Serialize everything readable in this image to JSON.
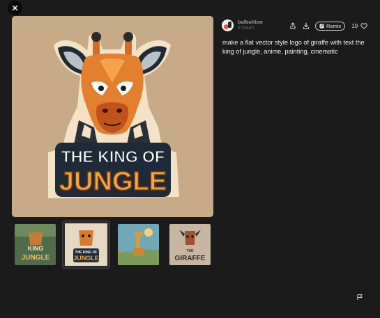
{
  "user": {
    "username": "balbolitoo",
    "time": "9 hours"
  },
  "actions": {
    "remix_label": "Remix",
    "like_count": "19"
  },
  "prompt": "make a flat vector style logo of giraffe with text the king of jungle, anime, painting, cinematic",
  "main_image": {
    "title_line1": "THE KING OF",
    "title_line2": "JUNGLE",
    "background": "#c7ab88"
  },
  "thumbnails": [
    {
      "line1": "KING",
      "line2": "JUNGLE",
      "selected": false
    },
    {
      "line1": "THE KING OF",
      "line2": "JUNGLE",
      "selected": true
    },
    {
      "line1": "",
      "line2": "",
      "selected": false
    },
    {
      "line1": "THE",
      "line2": "GIRAFFE",
      "selected": false
    }
  ],
  "icons": {
    "close": "close-icon",
    "share": "share-icon",
    "download": "download-icon",
    "remix": "remix-icon",
    "heart": "heart-icon",
    "flag": "flag-icon"
  }
}
